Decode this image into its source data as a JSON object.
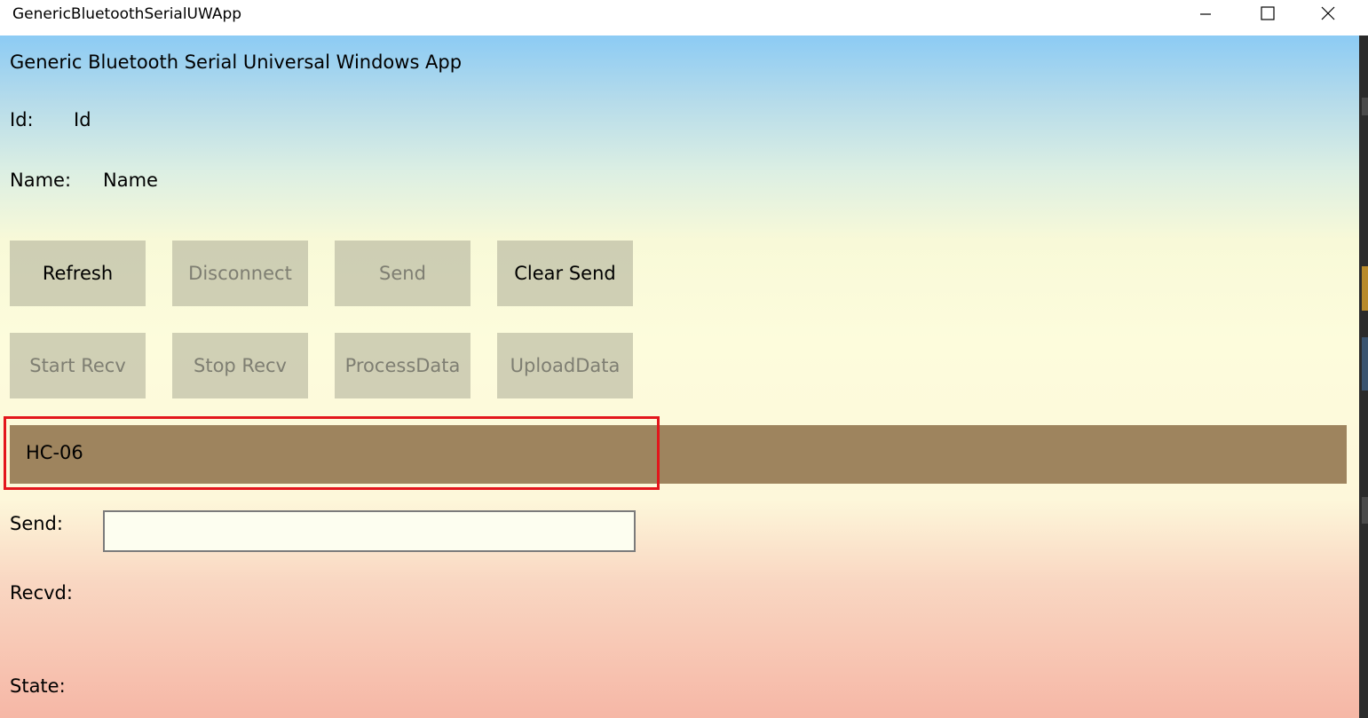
{
  "window": {
    "title": "GenericBluetoothSerialUWApp"
  },
  "app": {
    "title": "Generic Bluetooth Serial Universal Windows App",
    "id_label": "Id:",
    "id_value": "Id",
    "name_label": "Name:",
    "name_value": "Name",
    "buttons": [
      {
        "label": "Refresh",
        "enabled": true
      },
      {
        "label": "Disconnect",
        "enabled": false
      },
      {
        "label": "Send",
        "enabled": false
      },
      {
        "label": "Clear Send",
        "enabled": true
      },
      {
        "label": "Start Recv",
        "enabled": false
      },
      {
        "label": "Stop Recv",
        "enabled": false
      },
      {
        "label": "ProcessData",
        "enabled": false
      },
      {
        "label": "UploadData",
        "enabled": false
      }
    ],
    "devices": [
      {
        "name": "HC-06"
      }
    ],
    "send_label": "Send:",
    "send_value": "",
    "recvd_label": "Recvd:",
    "state_label": "State:"
  },
  "colors": {
    "device_list_bg": "#9e845e",
    "highlight": "#e3161c",
    "button_bg": "#b8b8a0"
  },
  "icons": {
    "minimize": "minimize-icon",
    "maximize": "maximize-icon",
    "close": "close-icon"
  }
}
